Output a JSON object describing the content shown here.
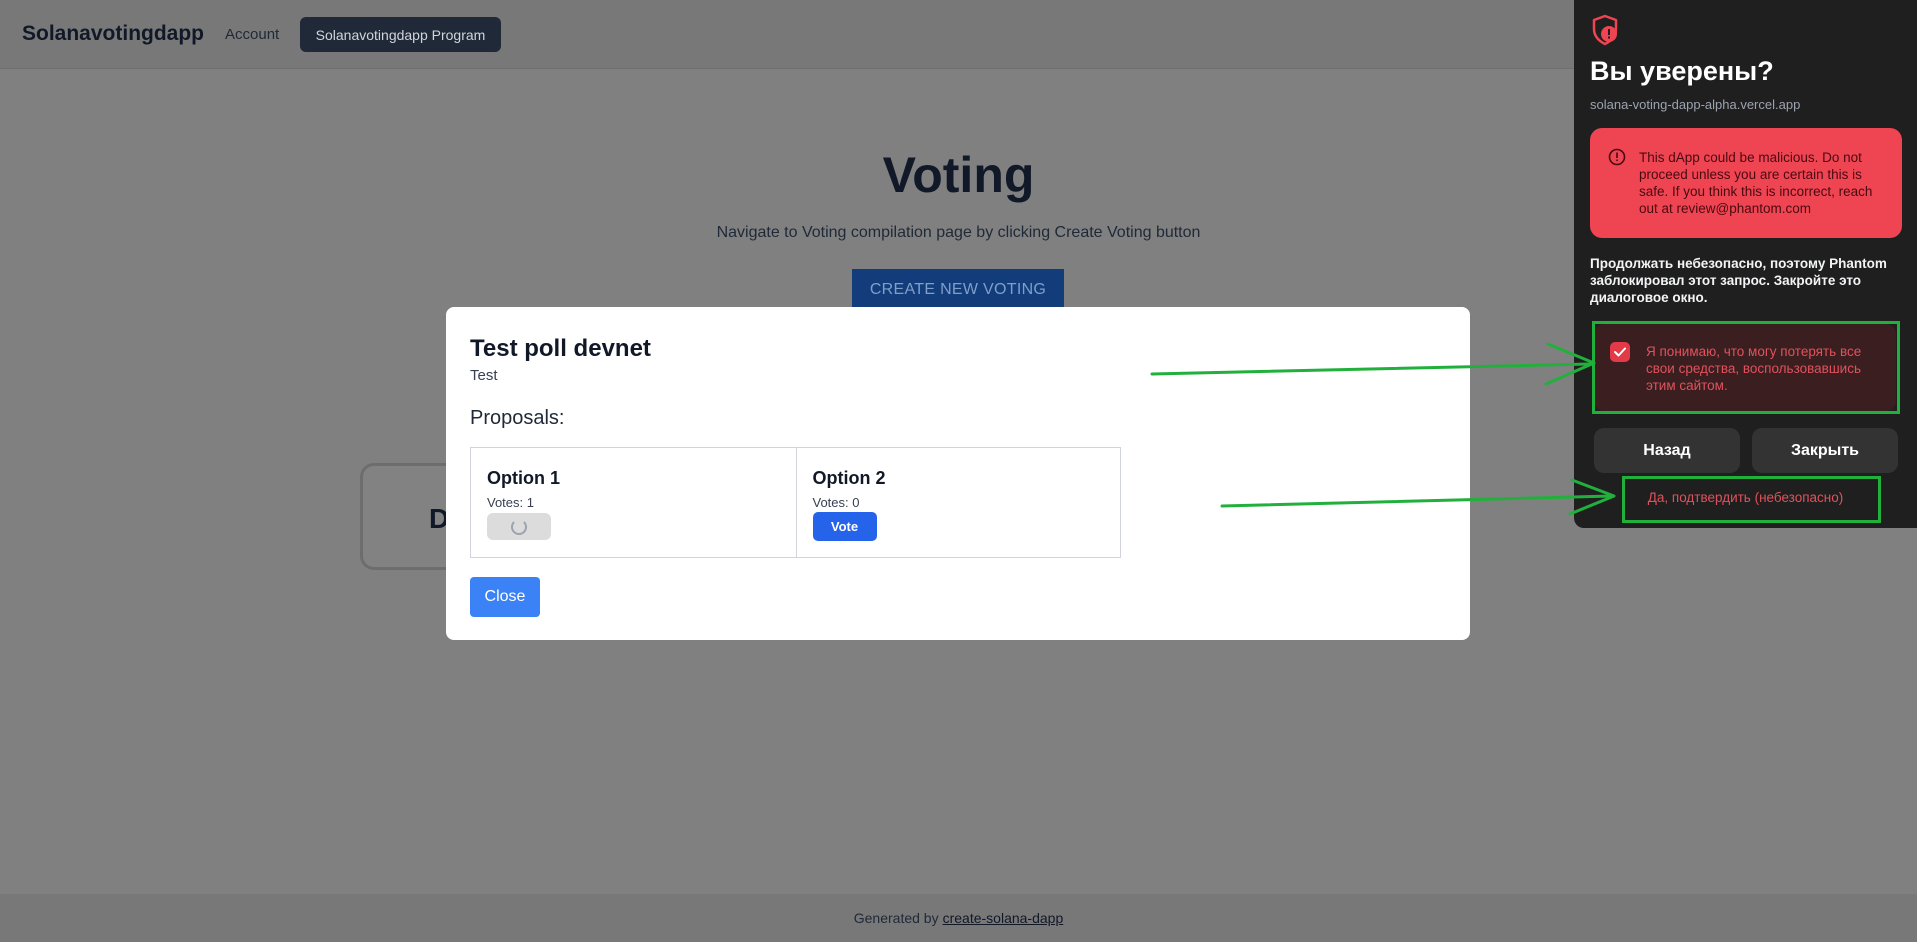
{
  "navbar": {
    "brand": "Solanavotingdapp",
    "account_link": "Account",
    "program_button": "Solanavotingdapp Program"
  },
  "hero": {
    "title": "Voting",
    "subtitle": "Navigate to Voting compilation page by clicking Create Voting button",
    "create_button": "CREATE NEW VOTING"
  },
  "background_card": {
    "letter": "D"
  },
  "modal": {
    "title": "Test poll devnet",
    "description": "Test",
    "proposals_heading": "Proposals:",
    "options": [
      {
        "name": "Option 1",
        "votes_text": "Votes: 1",
        "button_state": "loading"
      },
      {
        "name": "Option 2",
        "votes_text": "Votes: 0",
        "button_label": "Vote"
      }
    ],
    "close_button": "Close"
  },
  "footer": {
    "prefix": "Generated by",
    "link": "create-solana-dapp"
  },
  "phantom": {
    "title": "Вы уверены?",
    "domain": "solana-voting-dapp-alpha.vercel.app",
    "warning": "This dApp could be malicious. Do not proceed unless you are certain this is safe. If you think this is incorrect, reach out at review@phantom.com",
    "info": "Продолжать небезопасно, поэтому Phantom заблокировал этот запрос. Закройте это диалоговое окно.",
    "acknowledge": "Я понимаю, что могу потерять все свои средства, воспользовавшись этим сайтом.",
    "acknowledge_checked": true,
    "back_button": "Назад",
    "close_button": "Закрыть",
    "confirm_link": "Да, подтвердить (небезопасно)",
    "colors": {
      "danger": "#ef4452",
      "panel": "#1f1f1f"
    }
  },
  "annotations": {
    "color": "#22b03c"
  }
}
